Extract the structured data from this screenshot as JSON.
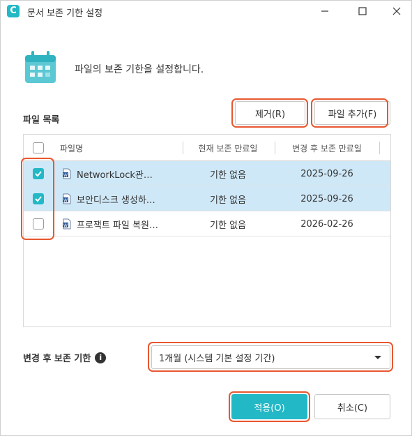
{
  "window": {
    "app_icon_letter": "C",
    "title": "문서 보존 기한 설정"
  },
  "header": {
    "description": "파일의 보존 기한을 설정합니다."
  },
  "file_list": {
    "label": "파일 목록",
    "remove_button": "제거(R)",
    "add_button": "파일 추가(F)",
    "columns": {
      "name": "파일명",
      "current": "현재 보존 만료일",
      "after": "변경 후 보존 만료일"
    },
    "rows": [
      {
        "checked": true,
        "name": "NetworkLock관…",
        "current": "기한 없음",
        "after": "2025-09-26"
      },
      {
        "checked": true,
        "name": "보안디스크 생성하…",
        "current": "기한 없음",
        "after": "2025-09-26"
      },
      {
        "checked": false,
        "name": "프로잭트 파일 복원…",
        "current": "기한 없음",
        "after": "2026-02-26"
      }
    ]
  },
  "retention": {
    "label": "변경 후 보존 기한",
    "info_glyph": "i",
    "selected": "1개월 (시스템 기본 설정 기간)"
  },
  "footer": {
    "apply": "적용(O)",
    "cancel": "취소(C)"
  },
  "colors": {
    "accent": "#22b8c6",
    "selected_row": "#cfe8f7",
    "highlight": "#e8572f"
  },
  "icons": [
    "app-icon",
    "minimize-icon",
    "maximize-icon",
    "close-icon",
    "calendar-icon",
    "word-file-icon",
    "info-icon",
    "dropdown-arrow-icon",
    "checkmark-icon"
  ]
}
